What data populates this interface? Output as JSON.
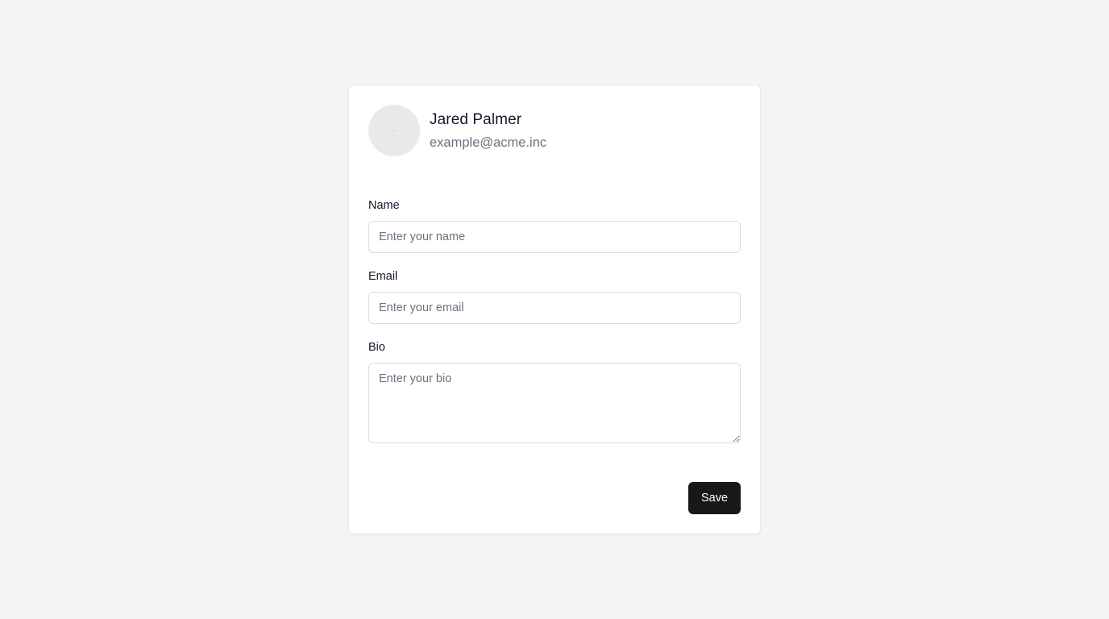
{
  "profile": {
    "name": "Jared Palmer",
    "email": "example@acme.inc",
    "avatar_icon": "avatar-placeholder"
  },
  "form": {
    "name_label": "Name",
    "name_placeholder": "Enter your name",
    "name_value": "",
    "email_label": "Email",
    "email_placeholder": "Enter your email",
    "email_value": "",
    "bio_label": "Bio",
    "bio_placeholder": "Enter your bio",
    "bio_value": ""
  },
  "actions": {
    "save_label": "Save"
  },
  "colors": {
    "page_background": "#f3f4f6",
    "card_background": "#ffffff",
    "primary_button": "#18181b",
    "muted_text": "#6b7280"
  }
}
